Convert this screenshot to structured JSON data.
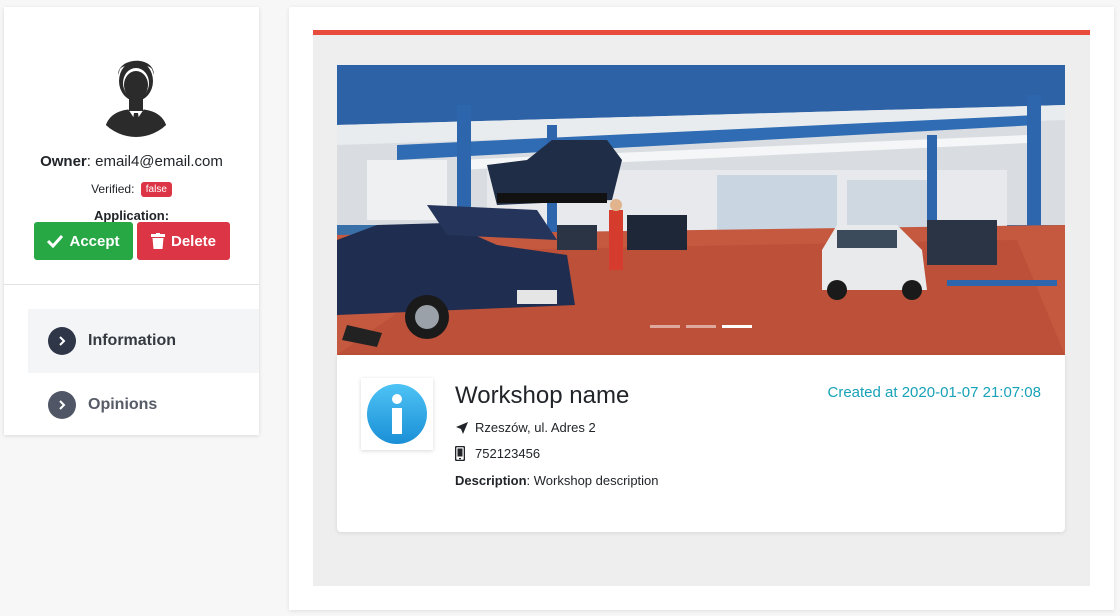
{
  "owner": {
    "label": "Owner",
    "email": "email4@email.com"
  },
  "verified": {
    "label": "Verified:",
    "value": "false"
  },
  "application": {
    "label": "Application:",
    "accept_label": "Accept",
    "delete_label": "Delete"
  },
  "nav": {
    "items": [
      {
        "label": "Information",
        "active": true
      },
      {
        "label": "Opinions",
        "active": false
      }
    ]
  },
  "carousel": {
    "slides": 3,
    "active_slide": 3
  },
  "workshop": {
    "name": "Workshop name",
    "created": "Created at 2020-01-07 21:07:08",
    "address": "Rzeszów, ul. Adres 2",
    "phone": "752123456",
    "description_label": "Description",
    "description": "Workshop description"
  },
  "colors": {
    "accent_red": "#e74c3c",
    "accept": "#28a745",
    "danger": "#dc3545",
    "teal": "#17a2b8"
  },
  "icons": [
    "user-avatar-icon",
    "check-icon",
    "trash-icon",
    "chevron-right-icon",
    "info-icon",
    "location-arrow-icon",
    "mobile-phone-icon"
  ]
}
